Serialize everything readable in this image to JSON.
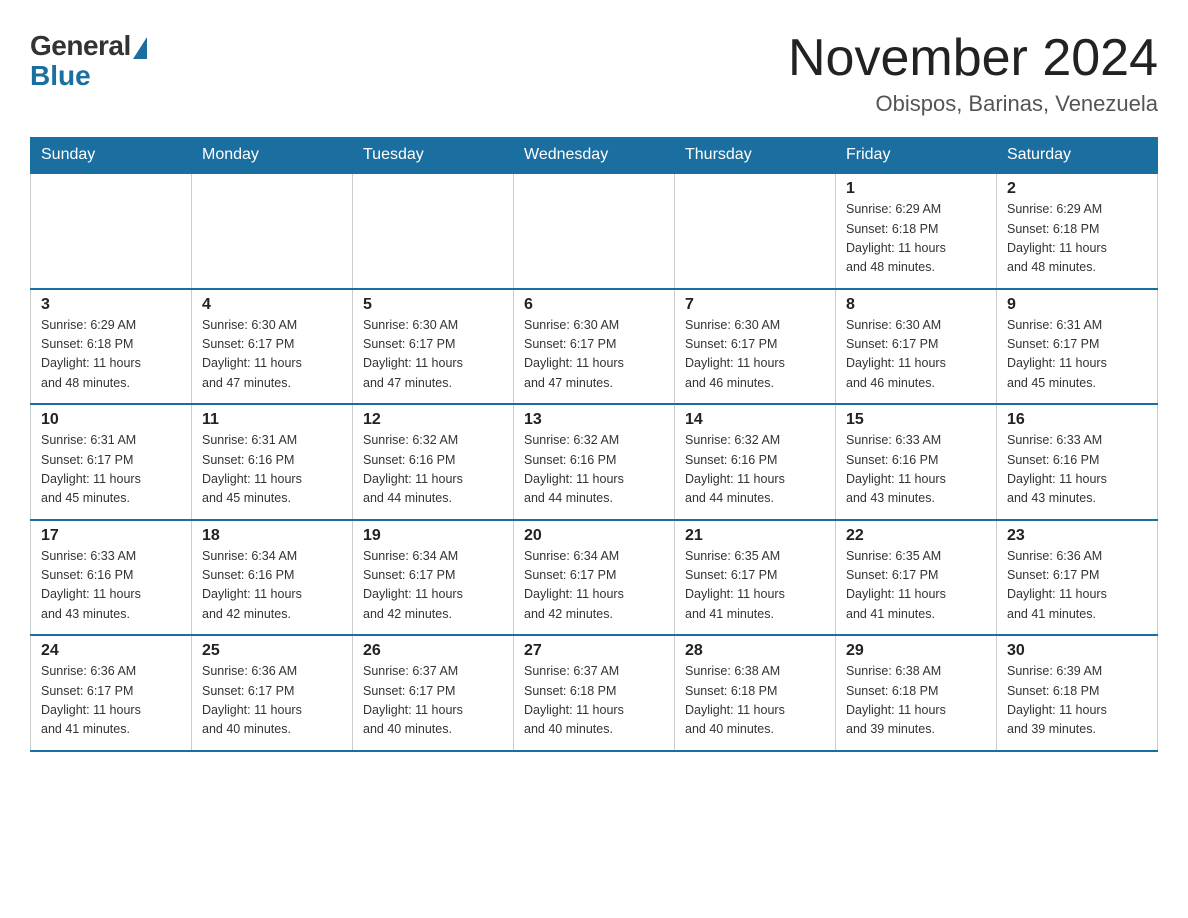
{
  "header": {
    "logo_general": "General",
    "logo_blue": "Blue",
    "month_title": "November 2024",
    "location": "Obispos, Barinas, Venezuela"
  },
  "days_of_week": [
    "Sunday",
    "Monday",
    "Tuesday",
    "Wednesday",
    "Thursday",
    "Friday",
    "Saturday"
  ],
  "weeks": [
    [
      {
        "day": "",
        "info": ""
      },
      {
        "day": "",
        "info": ""
      },
      {
        "day": "",
        "info": ""
      },
      {
        "day": "",
        "info": ""
      },
      {
        "day": "",
        "info": ""
      },
      {
        "day": "1",
        "info": "Sunrise: 6:29 AM\nSunset: 6:18 PM\nDaylight: 11 hours\nand 48 minutes."
      },
      {
        "day": "2",
        "info": "Sunrise: 6:29 AM\nSunset: 6:18 PM\nDaylight: 11 hours\nand 48 minutes."
      }
    ],
    [
      {
        "day": "3",
        "info": "Sunrise: 6:29 AM\nSunset: 6:18 PM\nDaylight: 11 hours\nand 48 minutes."
      },
      {
        "day": "4",
        "info": "Sunrise: 6:30 AM\nSunset: 6:17 PM\nDaylight: 11 hours\nand 47 minutes."
      },
      {
        "day": "5",
        "info": "Sunrise: 6:30 AM\nSunset: 6:17 PM\nDaylight: 11 hours\nand 47 minutes."
      },
      {
        "day": "6",
        "info": "Sunrise: 6:30 AM\nSunset: 6:17 PM\nDaylight: 11 hours\nand 47 minutes."
      },
      {
        "day": "7",
        "info": "Sunrise: 6:30 AM\nSunset: 6:17 PM\nDaylight: 11 hours\nand 46 minutes."
      },
      {
        "day": "8",
        "info": "Sunrise: 6:30 AM\nSunset: 6:17 PM\nDaylight: 11 hours\nand 46 minutes."
      },
      {
        "day": "9",
        "info": "Sunrise: 6:31 AM\nSunset: 6:17 PM\nDaylight: 11 hours\nand 45 minutes."
      }
    ],
    [
      {
        "day": "10",
        "info": "Sunrise: 6:31 AM\nSunset: 6:17 PM\nDaylight: 11 hours\nand 45 minutes."
      },
      {
        "day": "11",
        "info": "Sunrise: 6:31 AM\nSunset: 6:16 PM\nDaylight: 11 hours\nand 45 minutes."
      },
      {
        "day": "12",
        "info": "Sunrise: 6:32 AM\nSunset: 6:16 PM\nDaylight: 11 hours\nand 44 minutes."
      },
      {
        "day": "13",
        "info": "Sunrise: 6:32 AM\nSunset: 6:16 PM\nDaylight: 11 hours\nand 44 minutes."
      },
      {
        "day": "14",
        "info": "Sunrise: 6:32 AM\nSunset: 6:16 PM\nDaylight: 11 hours\nand 44 minutes."
      },
      {
        "day": "15",
        "info": "Sunrise: 6:33 AM\nSunset: 6:16 PM\nDaylight: 11 hours\nand 43 minutes."
      },
      {
        "day": "16",
        "info": "Sunrise: 6:33 AM\nSunset: 6:16 PM\nDaylight: 11 hours\nand 43 minutes."
      }
    ],
    [
      {
        "day": "17",
        "info": "Sunrise: 6:33 AM\nSunset: 6:16 PM\nDaylight: 11 hours\nand 43 minutes."
      },
      {
        "day": "18",
        "info": "Sunrise: 6:34 AM\nSunset: 6:16 PM\nDaylight: 11 hours\nand 42 minutes."
      },
      {
        "day": "19",
        "info": "Sunrise: 6:34 AM\nSunset: 6:17 PM\nDaylight: 11 hours\nand 42 minutes."
      },
      {
        "day": "20",
        "info": "Sunrise: 6:34 AM\nSunset: 6:17 PM\nDaylight: 11 hours\nand 42 minutes."
      },
      {
        "day": "21",
        "info": "Sunrise: 6:35 AM\nSunset: 6:17 PM\nDaylight: 11 hours\nand 41 minutes."
      },
      {
        "day": "22",
        "info": "Sunrise: 6:35 AM\nSunset: 6:17 PM\nDaylight: 11 hours\nand 41 minutes."
      },
      {
        "day": "23",
        "info": "Sunrise: 6:36 AM\nSunset: 6:17 PM\nDaylight: 11 hours\nand 41 minutes."
      }
    ],
    [
      {
        "day": "24",
        "info": "Sunrise: 6:36 AM\nSunset: 6:17 PM\nDaylight: 11 hours\nand 41 minutes."
      },
      {
        "day": "25",
        "info": "Sunrise: 6:36 AM\nSunset: 6:17 PM\nDaylight: 11 hours\nand 40 minutes."
      },
      {
        "day": "26",
        "info": "Sunrise: 6:37 AM\nSunset: 6:17 PM\nDaylight: 11 hours\nand 40 minutes."
      },
      {
        "day": "27",
        "info": "Sunrise: 6:37 AM\nSunset: 6:18 PM\nDaylight: 11 hours\nand 40 minutes."
      },
      {
        "day": "28",
        "info": "Sunrise: 6:38 AM\nSunset: 6:18 PM\nDaylight: 11 hours\nand 40 minutes."
      },
      {
        "day": "29",
        "info": "Sunrise: 6:38 AM\nSunset: 6:18 PM\nDaylight: 11 hours\nand 39 minutes."
      },
      {
        "day": "30",
        "info": "Sunrise: 6:39 AM\nSunset: 6:18 PM\nDaylight: 11 hours\nand 39 minutes."
      }
    ]
  ]
}
